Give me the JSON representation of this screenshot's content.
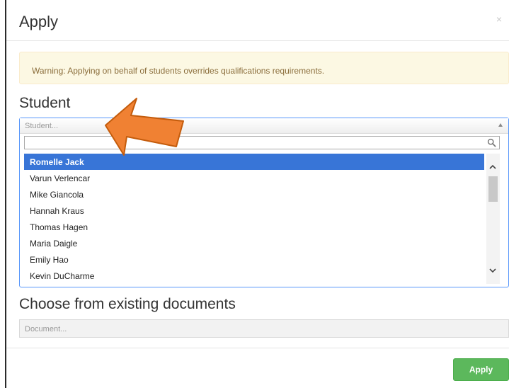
{
  "modal": {
    "title": "Apply",
    "close_glyph": "×"
  },
  "warning": {
    "text": "Warning: Applying on behalf of students overrides qualifications requirements."
  },
  "student": {
    "label": "Student",
    "placeholder": "Student...",
    "search_value": "",
    "results": [
      "Romelle Jack",
      "Varun Verlencar",
      "Mike Giancola",
      "Hannah Kraus",
      "Thomas Hagen",
      "Maria Daigle",
      "Emily Hao",
      "Kevin DuCharme"
    ],
    "highlighted_result": "Romelle Jack"
  },
  "documents": {
    "label": "Choose from existing documents",
    "placeholder": "Document..."
  },
  "footer": {
    "apply_label": "Apply"
  },
  "colors": {
    "highlight": "#3875d7",
    "warning_bg": "#fcf8e3",
    "warning_text": "#8a6d3b",
    "apply_button": "#5cb85c",
    "annotation_arrow": "#f08133"
  },
  "icons": {
    "search": "search-icon",
    "close": "close-icon",
    "select_arrow": "caret-up-icon",
    "annotation": "arrow-annotation-icon"
  }
}
